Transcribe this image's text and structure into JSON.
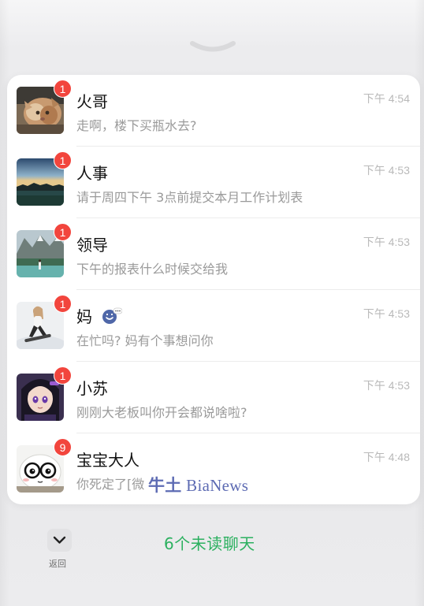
{
  "chats": [
    {
      "name": "火哥",
      "time": "下午 4:54",
      "preview": "走啊，楼下买瓶水去?",
      "badge": "1",
      "avatar": "cat-photo"
    },
    {
      "name": "人事",
      "time": "下午 4:53",
      "preview": "请于周四下午 3点前提交本月工作计划表",
      "badge": "1",
      "avatar": "lake-sunset-photo"
    },
    {
      "name": "领导",
      "time": "下午 4:53",
      "preview": "下午的报表什么时候交给我",
      "badge": "1",
      "avatar": "mountain-lake-photo"
    },
    {
      "name": "妈",
      "time": "下午 4:53",
      "preview": "在忙吗? 妈有个事想问你",
      "badge": "1",
      "avatar": "snowboard-photo",
      "status_icon": "typing-emoji-icon"
    },
    {
      "name": "小苏",
      "time": "下午 4:53",
      "preview": "刚刚大老板叫你开会都说啥啦?",
      "badge": "1",
      "avatar": "anime-girl-avatar"
    },
    {
      "name": "宝宝大人",
      "time": "下午 4:48",
      "preview": "你死定了[微",
      "badge": "9",
      "avatar": "glasses-cat-cartoon"
    }
  ],
  "watermark": {
    "cn": "牛土",
    "en": " BiaNews"
  },
  "footer": {
    "back_label": "返回",
    "back_icon": "chevron-down-icon",
    "unread_summary": "6个未读聊天"
  },
  "colors": {
    "badge": "#f2453d",
    "accent_green": "#2bb05f",
    "watermark": "#5d6bb3"
  }
}
